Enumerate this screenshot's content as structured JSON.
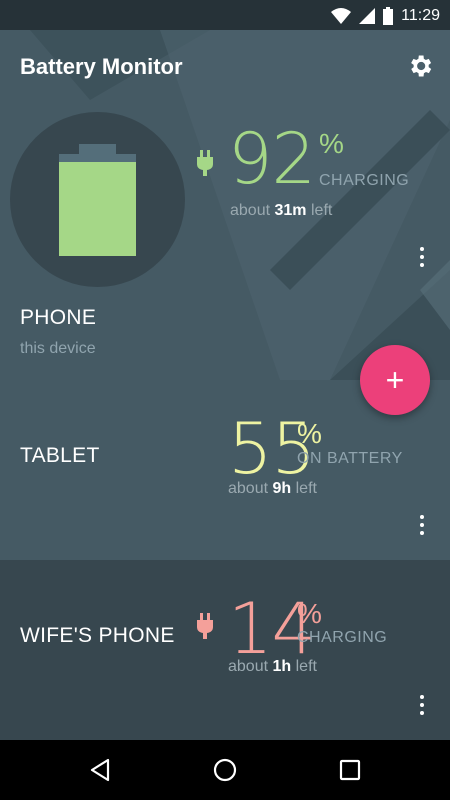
{
  "status_bar": {
    "time": "11:29",
    "icons": [
      "wifi-icon",
      "signal-icon",
      "battery-icon"
    ]
  },
  "app": {
    "title": "Battery Monitor",
    "settings_icon": "gear-icon",
    "fab_label": "+"
  },
  "devices": [
    {
      "name": "PHONE",
      "subtitle": "this device",
      "level": 92,
      "percent_sign": "%",
      "state": "CHARGING",
      "time_prefix": "about",
      "time_value": "31m",
      "time_suffix": "left",
      "color": "#a5d787",
      "charging": true
    },
    {
      "name": "TABLET",
      "level": 55,
      "percent_sign": "%",
      "state": "ON BATTERY",
      "time_prefix": "about",
      "time_value": "9h",
      "time_suffix": "left",
      "color": "#eef3a2",
      "charging": false
    },
    {
      "name": "WIFE'S PHONE",
      "level": 14,
      "percent_sign": "%",
      "state": "CHARGING",
      "time_prefix": "about",
      "time_value": "1h",
      "time_suffix": "left",
      "color": "#f4a09a",
      "charging": true
    }
  ],
  "nav": {
    "icons": [
      "back-icon",
      "home-icon",
      "recents-icon"
    ]
  }
}
